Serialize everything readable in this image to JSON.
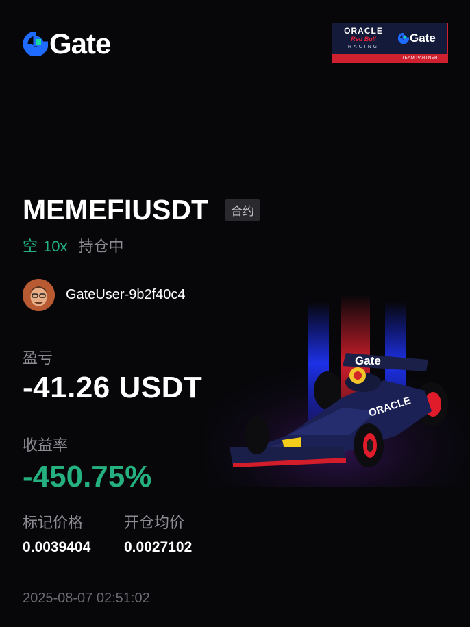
{
  "brand": {
    "name": "Gate"
  },
  "partner": {
    "oracle": "ORACLE",
    "redbull": "Red Bull",
    "racing": "RACING",
    "gate": "Gate",
    "tag": "TEAM PARTNER"
  },
  "position": {
    "symbol": "MEMEFIUSDT",
    "contract_badge": "合约",
    "side": "空",
    "leverage": "10x",
    "status": "持仓中"
  },
  "user": {
    "name": "GateUser-9b2f40c4"
  },
  "pnl": {
    "label": "盈亏",
    "value": "-41.26 USDT"
  },
  "roe": {
    "label": "收益率",
    "value": "-450.75%"
  },
  "prices": {
    "mark_label": "标记价格",
    "mark_value": "0.0039404",
    "entry_label": "开仓均价",
    "entry_value": "0.0027102"
  },
  "timestamp": "2025-08-07 02:51:02",
  "car_livery_text": "Gate",
  "car_sidepod_text": "ORACLE",
  "colors": {
    "accent_green": "#25b07f",
    "brand_blue": "#1f6bff",
    "brand_teal": "#16d9a0",
    "partner_red": "#cf2030"
  }
}
